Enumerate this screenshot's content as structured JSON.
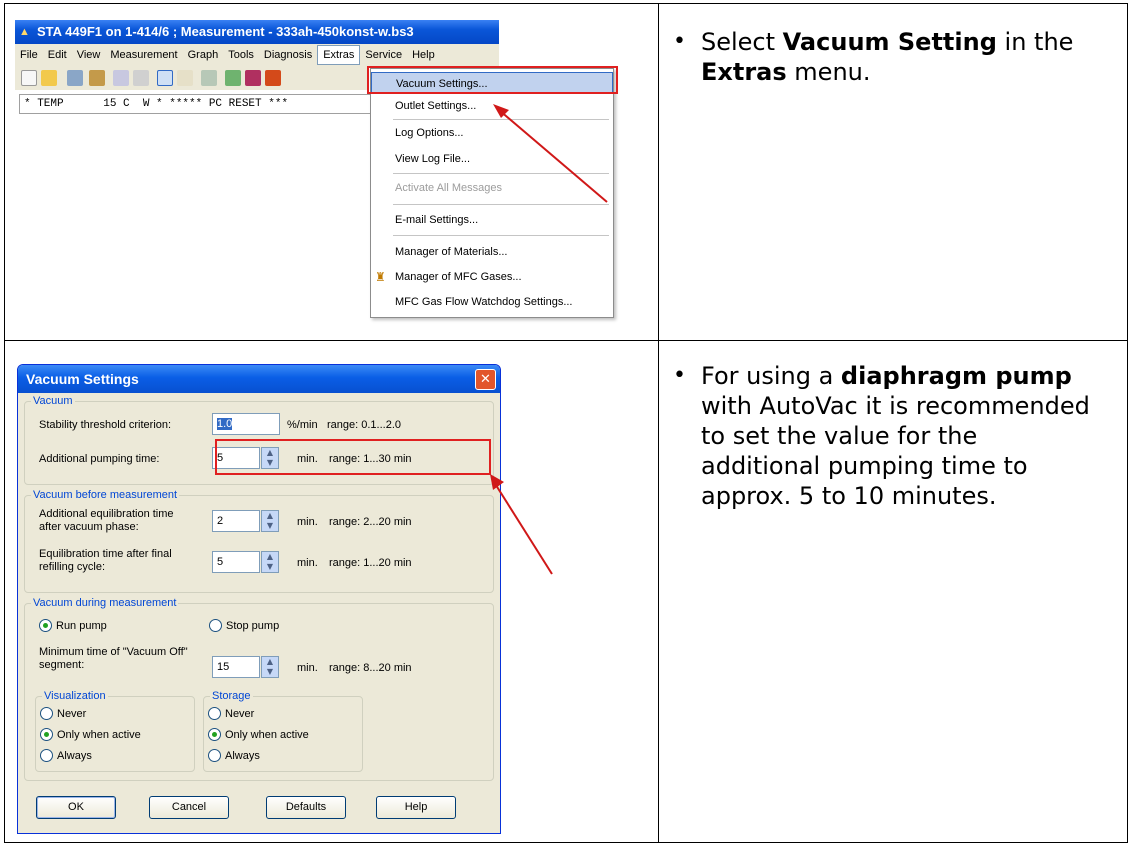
{
  "top_screenshot": {
    "window_title": "STA 449F1 on 1-414/6 ; Measurement  - 333ah-450konst-w.bs3",
    "menu": [
      "File",
      "Edit",
      "View",
      "Measurement",
      "Graph",
      "Tools",
      "Diagnosis",
      "Extras",
      "Service",
      "Help"
    ],
    "active_menu": "Extras",
    "status_line": "* TEMP      15 C  W * ***** PC RESET ***",
    "extras_menu": [
      {
        "label": "Vacuum Settings...",
        "highlighted": true
      },
      {
        "label": "Outlet Settings..."
      },
      {
        "label": "Log Options..."
      },
      {
        "label": "View Log File..."
      },
      {
        "label": "Activate All Messages",
        "disabled": true
      },
      {
        "label": "E-mail Settings..."
      },
      {
        "label": "Manager of Materials..."
      },
      {
        "label": "Manager of MFC Gases...",
        "icon": "gas-bottles-icon"
      },
      {
        "label": "MFC Gas Flow Watchdog Settings..."
      }
    ]
  },
  "instructions": {
    "step1": {
      "pre": "Select ",
      "bold1": "Vacuum Setting",
      "mid": " in the ",
      "bold2": "Extras",
      "post": " menu."
    },
    "step2": {
      "pre": "For using a ",
      "bold": "diaphragm pump",
      "line2": "with AutoVac it is recommended",
      "line3": "to set the value for the",
      "line4": "additional pumping time to",
      "line5": "approx. 5 to 10 minutes."
    }
  },
  "dialog": {
    "title": "Vacuum Settings",
    "vacuum": {
      "group_label": "Vacuum",
      "stability_label": "Stability threshold criterion:",
      "stability_value": "1.0",
      "stability_unit": "%/min",
      "stability_range": "range: 0.1...2.0",
      "pumping_label": "Additional pumping time:",
      "pumping_value": "5",
      "pumping_unit": "min.",
      "pumping_range": "range: 1...30 min"
    },
    "before": {
      "group_label": "Vacuum before measurement",
      "equil_label_1": "Additional equilibration time",
      "equil_label_2": "after vacuum phase:",
      "equil_value": "2",
      "equil_unit": "min.",
      "equil_range": "range: 2...20 min",
      "refill_label_1": "Equilibration time after final",
      "refill_label_2": "refilling cycle:",
      "refill_value": "5",
      "refill_unit": "min.",
      "refill_range": "range: 1...20 min"
    },
    "during": {
      "group_label": "Vacuum during measurement",
      "run_pump": "Run pump",
      "stop_pump": "Stop pump",
      "selected": "run_pump",
      "min_time_label_1": "Minimum time of \"Vacuum Off\"",
      "min_time_label_2": "segment:",
      "min_time_value": "15",
      "min_time_unit": "min.",
      "min_time_range": "range: 8...20 min",
      "visualization": {
        "label": "Visualization",
        "options": [
          "Never",
          "Only when active",
          "Always"
        ],
        "selected": "Only when active"
      },
      "storage": {
        "label": "Storage",
        "options": [
          "Never",
          "Only when active",
          "Always"
        ],
        "selected": "Only when active"
      }
    },
    "buttons": {
      "ok": "OK",
      "cancel": "Cancel",
      "defaults": "Defaults",
      "help": "Help"
    }
  },
  "colors": {
    "highlight_box": "#e02020",
    "xp_blue": "#0a5ee6",
    "dialog_bg": "#ece9d8"
  }
}
